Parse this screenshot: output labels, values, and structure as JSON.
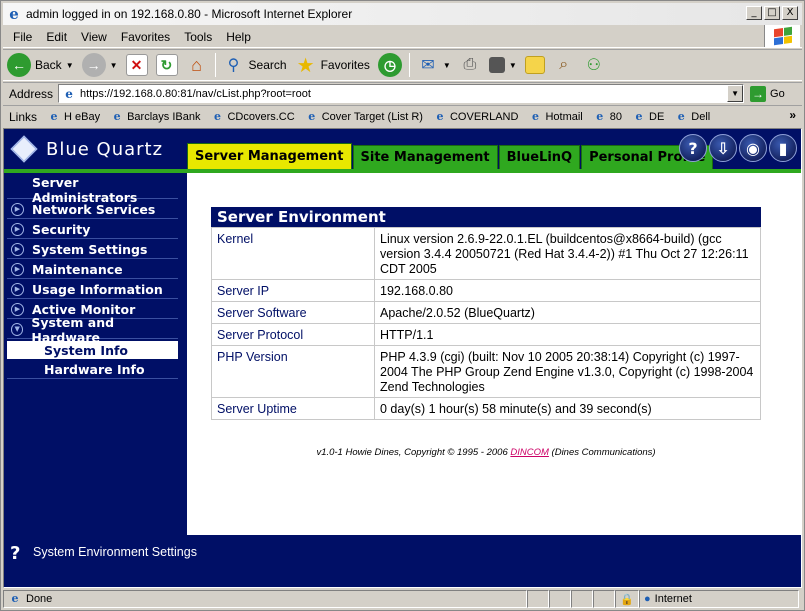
{
  "window": {
    "title": "admin logged in on 192.168.0.80 - Microsoft Internet Explorer",
    "min": "_",
    "max": "□",
    "close": "X"
  },
  "menu": [
    "File",
    "Edit",
    "View",
    "Favorites",
    "Tools",
    "Help"
  ],
  "toolbar": {
    "back": "Back",
    "search": "Search",
    "favorites": "Favorites"
  },
  "address": {
    "label": "Address",
    "url": "https://192.168.0.80:81/nav/cList.php?root=root",
    "go": "Go"
  },
  "links": {
    "label": "Links",
    "items": [
      "H eBay",
      "Barclays IBank",
      "CDcovers.CC",
      "Cover Target (List R)",
      "COVERLAND",
      "Hotmail",
      "80",
      "DE",
      "Dell"
    ],
    "more": "»"
  },
  "app": {
    "logo": "Blue Quartz",
    "tabs": [
      "Server Management",
      "Site Management",
      "BlueLinQ",
      "Personal Profile"
    ],
    "header_icons": [
      "help-icon",
      "logout-icon",
      "view-icon",
      "exit-icon"
    ]
  },
  "sidebar": {
    "items": [
      {
        "label": "Server Administrators",
        "type": "plain"
      },
      {
        "label": "Network Services",
        "type": "collapsed"
      },
      {
        "label": "Security",
        "type": "collapsed"
      },
      {
        "label": "System Settings",
        "type": "collapsed"
      },
      {
        "label": "Maintenance",
        "type": "collapsed"
      },
      {
        "label": "Usage Information",
        "type": "collapsed"
      },
      {
        "label": "Active Monitor",
        "type": "collapsed"
      },
      {
        "label": "System and Hardware",
        "type": "expanded"
      }
    ],
    "subitems": [
      "System Info",
      "Hardware Info"
    ],
    "selected": "System Info"
  },
  "panel": {
    "title": "Server Environment",
    "rows": [
      {
        "key": "Kernel",
        "value": "Linux version 2.6.9-22.0.1.EL (buildcentos@x8664-build) (gcc version 3.4.4 20050721 (Red Hat 3.4.4-2)) #1 Thu Oct 27 12:26:11 CDT 2005"
      },
      {
        "key": "Server IP",
        "value": "192.168.0.80"
      },
      {
        "key": "Server Software",
        "value": "Apache/2.0.52 (BlueQuartz)"
      },
      {
        "key": "Server Protocol",
        "value": "HTTP/1.1"
      },
      {
        "key": "PHP Version",
        "value": "PHP 4.3.9 (cgi) (built: Nov 10 2005 20:38:14) Copyright (c) 1997-2004 The PHP Group Zend Engine v1.3.0, Copyright (c) 1998-2004 Zend Technologies"
      },
      {
        "key": "Server Uptime",
        "value": "0 day(s) 1 hour(s) 58 minute(s) and 39 second(s)"
      }
    ]
  },
  "footer": {
    "pre": "v1.0-1 Howie Dines, Copyright © 1995 - 2006 ",
    "link": "DINCOM",
    "post": " (Dines Communications)"
  },
  "help": {
    "mark": "?",
    "text": "System Environment Settings"
  },
  "status": {
    "text": "Done",
    "zone": "Internet"
  },
  "colors": {
    "navy": "#000f66",
    "green_tab": "#2fa81f",
    "active_tab": "#e8e800"
  }
}
